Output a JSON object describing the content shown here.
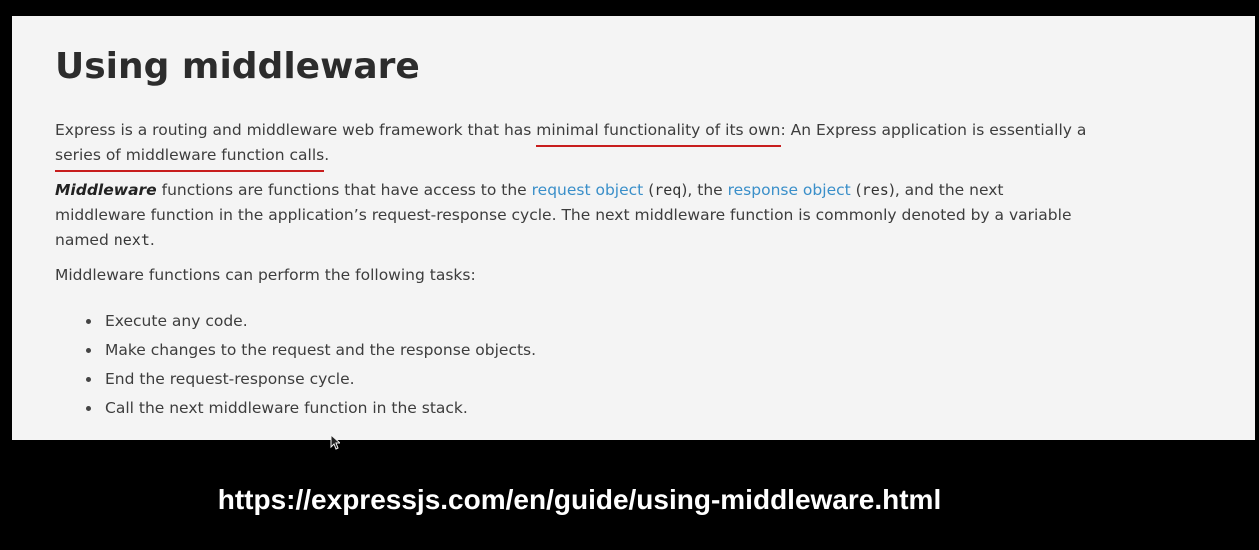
{
  "page": {
    "heading": "Using middleware",
    "intro": {
      "part1": "Express is a routing and middleware web framework that has ",
      "highlight1": "minimal functionality of its own",
      "part2": ": An Express application is essentially a",
      "highlight2": "series of middleware function calls",
      "part3": "."
    },
    "definition": {
      "term": "Middleware",
      "text1": " functions are functions that have access to the ",
      "link_request": "request object",
      "text2": " (",
      "code_req": "req",
      "text3": "), the ",
      "link_response": "response object",
      "text4": " (",
      "code_res": "res",
      "text5": "), and the next",
      "line2": "middleware function in the application’s request-response cycle. The next middleware function is commonly denoted by a variable",
      "line3_prefix": "named ",
      "code_next": "next",
      "line3_suffix": "."
    },
    "tasks_intro": "Middleware functions can perform the following tasks:",
    "tasks": [
      "Execute any code.",
      "Make changes to the request and the response objects.",
      "End the request-response cycle.",
      "Call the next middleware function in the stack."
    ]
  },
  "caption": {
    "url": "https://expressjs.com/en/guide/using-middleware.html"
  },
  "colors": {
    "link": "#3a8fc9",
    "underline_annotation": "#c81e1e",
    "page_background": "#f4f4f4",
    "frame_background": "#000000"
  },
  "icons": {
    "cursor": "mouse-pointer-icon"
  }
}
